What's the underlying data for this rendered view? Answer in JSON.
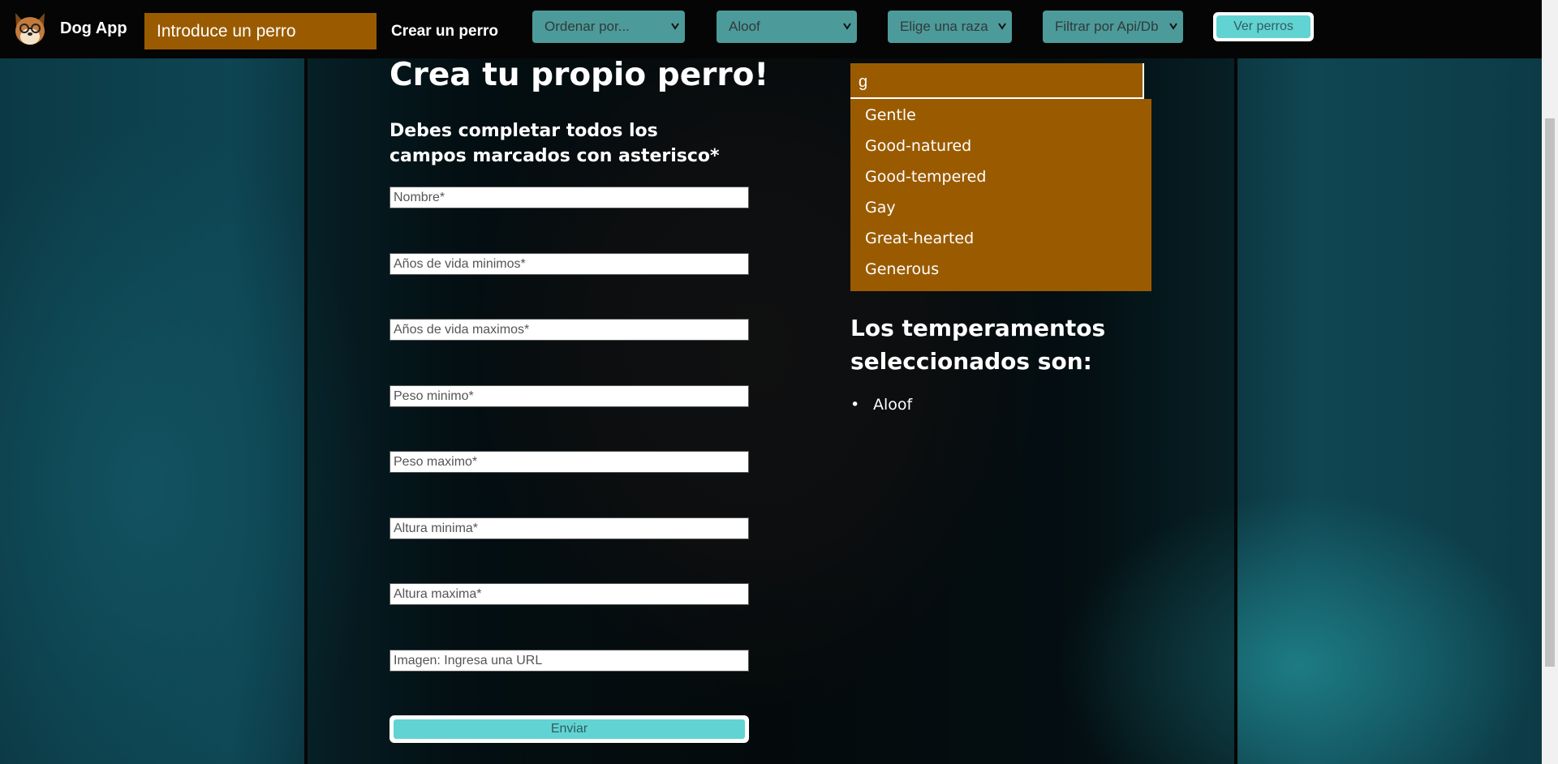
{
  "nav": {
    "brand": "Dog App",
    "search_placeholder": "Introduce un perro",
    "create_link": "Crear un perro",
    "sort_select": "Ordenar por...",
    "temperament_select": "Aloof",
    "breed_select": "Elige una raza",
    "source_select": "Filtrar por Api/Db",
    "view_button": "Ver perros"
  },
  "form": {
    "title": "Crea tu propio perro!",
    "subtitle": "Debes completar todos los campos marcados con asterisco*",
    "fields": {
      "name": "Nombre*",
      "life_min": "Años de vida minimos*",
      "life_max": "Años de vida maximos*",
      "weight_min": "Peso minimo*",
      "weight_max": "Peso maximo*",
      "height_min": "Altura minima*",
      "height_max": "Altura maxima*",
      "image": "Imagen: Ingresa una URL"
    },
    "submit": "Enviar"
  },
  "temperaments": {
    "input_value": "g",
    "options": [
      "Gentle",
      "Good-natured",
      "Good-tempered",
      "Gay",
      "Great-hearted",
      "Generous"
    ],
    "selected_title": "Los temperamentos seleccionados son:",
    "selected": [
      "Aloof"
    ]
  },
  "colors": {
    "accent_brown": "#9a5b00",
    "accent_teal": "#62d3d3",
    "select_teal": "#4d9a9a"
  }
}
